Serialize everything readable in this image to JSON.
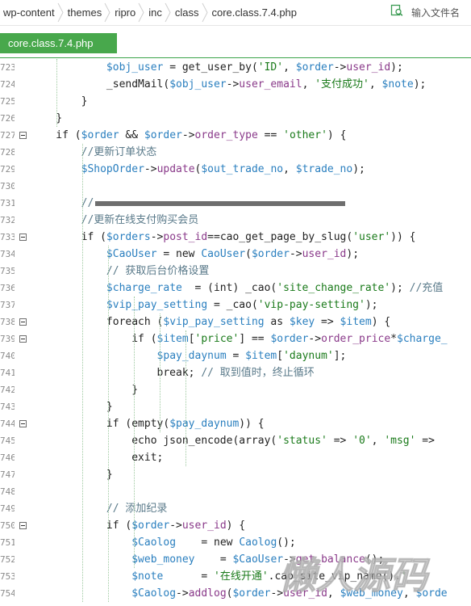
{
  "breadcrumb": [
    "wp-content",
    "themes",
    "ripro",
    "inc",
    "class",
    "core.class.7.4.php"
  ],
  "search": {
    "placeholder": "输入文件名"
  },
  "tab": {
    "label": "core.class.7.4.php"
  },
  "watermark": {
    "text": "懒人源码"
  },
  "colors": {
    "tab": "#48a84c",
    "variable": "#2a7fbf",
    "string": "#1a7a1a",
    "comment": "#5a7a8a"
  },
  "code": [
    {
      "n": "723",
      "text": "            $obj_user = get_user_by('ID', $order->user_id);"
    },
    {
      "n": "724",
      "text": "            _sendMail($obj_user->user_email, '支付成功', $note);"
    },
    {
      "n": "725",
      "text": "        }"
    },
    {
      "n": "726",
      "text": "    }"
    },
    {
      "n": "727",
      "text": "    if ($order && $order->order_type == 'other') {",
      "fold": true
    },
    {
      "n": "728",
      "text": "        //更新订单状态"
    },
    {
      "n": "729",
      "text": "        $ShopOrder->update($out_trade_no, $trade_no);"
    },
    {
      "n": "730",
      "text": ""
    },
    {
      "n": "731",
      "text": "        //",
      "obfuscated": true
    },
    {
      "n": "732",
      "text": "        //更新在线支付购买会员"
    },
    {
      "n": "733",
      "text": "        if ($orders->post_id==cao_get_page_by_slug('user')) {",
      "fold": true
    },
    {
      "n": "734",
      "text": "            $CaoUser = new CaoUser($order->user_id);"
    },
    {
      "n": "735",
      "text": "            // 获取后台价格设置"
    },
    {
      "n": "736",
      "text": "            $charge_rate  = (int) _cao('site_change_rate'); //充值"
    },
    {
      "n": "737",
      "text": "            $vip_pay_setting = _cao('vip-pay-setting');"
    },
    {
      "n": "738",
      "text": "            foreach ($vip_pay_setting as $key => $item) {",
      "fold": true
    },
    {
      "n": "739",
      "text": "                if ($item['price'] == $order->order_price*$charge_",
      "fold": true
    },
    {
      "n": "740",
      "text": "                    $pay_daynum = $item['daynum'];"
    },
    {
      "n": "741",
      "text": "                    break; // 取到值时，终止循环"
    },
    {
      "n": "742",
      "text": "                }"
    },
    {
      "n": "743",
      "text": "            }"
    },
    {
      "n": "744",
      "text": "            if (empty($pay_daynum)) {",
      "fold": true
    },
    {
      "n": "745",
      "text": "                echo json_encode(array('status' => '0', 'msg' => "
    },
    {
      "n": "746",
      "text": "                exit;"
    },
    {
      "n": "747",
      "text": "            }"
    },
    {
      "n": "748",
      "text": ""
    },
    {
      "n": "749",
      "text": "            // 添加纪录"
    },
    {
      "n": "750",
      "text": "            if ($order->user_id) {",
      "fold": true
    },
    {
      "n": "751",
      "text": "                $Caolog    = new Caolog();"
    },
    {
      "n": "752",
      "text": "                $web_money    = $CaoUser->get_balance();"
    },
    {
      "n": "753",
      "text": "                $note      = '在线开通'.cao_site_vip_name().'"
    },
    {
      "n": "754",
      "text": "                $Caolog->addlog($order->user_id, $web_money, $orde"
    }
  ]
}
